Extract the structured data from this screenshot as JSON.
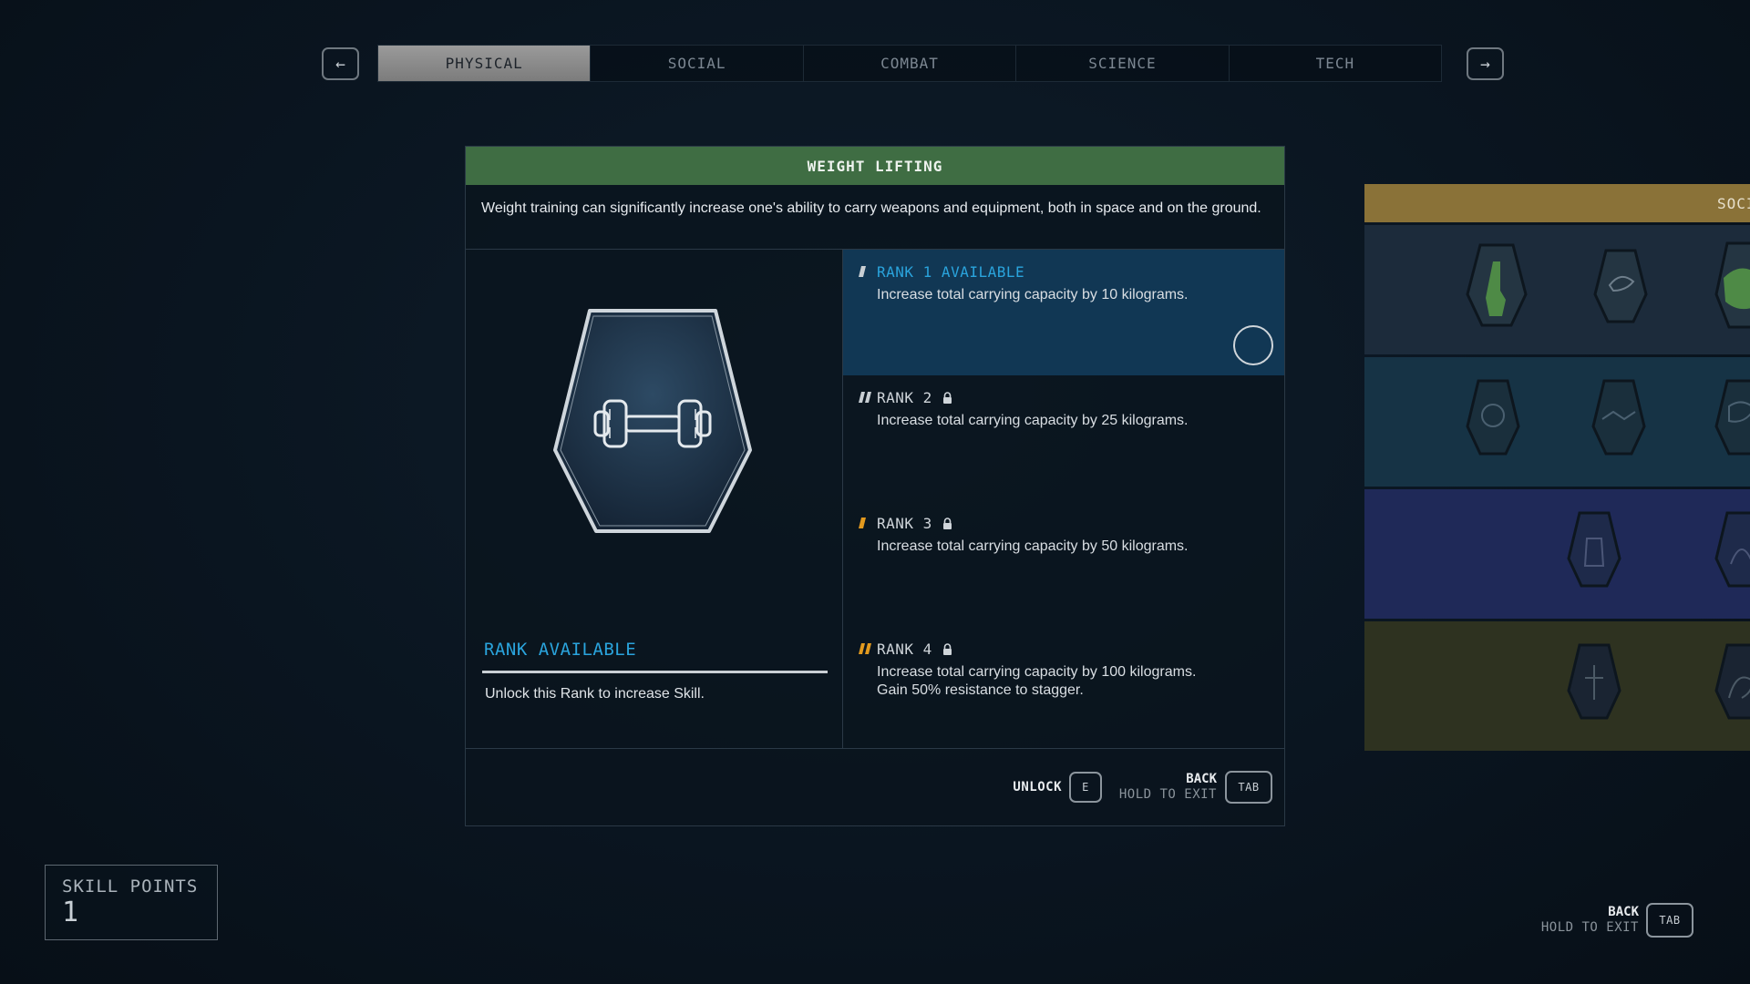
{
  "nav": {
    "prev_arrow": "←",
    "next_arrow": "→"
  },
  "tabs": [
    {
      "label": "PHYSICAL",
      "active": true
    },
    {
      "label": "SOCIAL",
      "active": false
    },
    {
      "label": "COMBAT",
      "active": false
    },
    {
      "label": "SCIENCE",
      "active": false
    },
    {
      "label": "TECH",
      "active": false
    }
  ],
  "skill": {
    "title": "WEIGHT LIFTING",
    "description": "Weight training can significantly increase one's ability to carry weapons and equipment, both in space and on the ground.",
    "icon": "dumbbell-icon",
    "status_title": "RANK AVAILABLE",
    "status_text": "Unlock this Rank to increase Skill.",
    "ranks": [
      {
        "label": "RANK 1 AVAILABLE",
        "description": "Increase total carrying capacity by 10 kilograms.",
        "locked": false,
        "selected": true,
        "bar_color": "#c9cfd4"
      },
      {
        "label": "RANK 2",
        "description": "Increase total carrying capacity by 25 kilograms.",
        "locked": true,
        "selected": false,
        "bar_color": "#c9cfd4"
      },
      {
        "label": "RANK 3",
        "description": "Increase total carrying capacity by 50 kilograms.",
        "locked": true,
        "selected": false,
        "bar_color": "#e39a1e"
      },
      {
        "label": "RANK 4",
        "description": "Increase total carrying capacity by 100 kilograms.\nGain 50% resistance to stagger.",
        "locked": true,
        "selected": false,
        "bar_color": "#e39a1e"
      }
    ]
  },
  "footer": {
    "unlock_label": "UNLOCK",
    "unlock_key": "E",
    "back_label": "BACK",
    "hold_label": "HOLD TO EXIT",
    "back_key": "TAB"
  },
  "side_panel": {
    "header": "SOCIAL"
  },
  "skill_points": {
    "label": "SKILL POINTS",
    "value": "1"
  },
  "global_back": {
    "back_label": "BACK",
    "hold_label": "HOLD TO EXIT",
    "key": "TAB"
  },
  "colors": {
    "physical_green": "#3f6d43",
    "social_gold": "#8a7238",
    "rank_available_blue": "#2aa4dd",
    "rank_locked_orange": "#e39a1e"
  }
}
